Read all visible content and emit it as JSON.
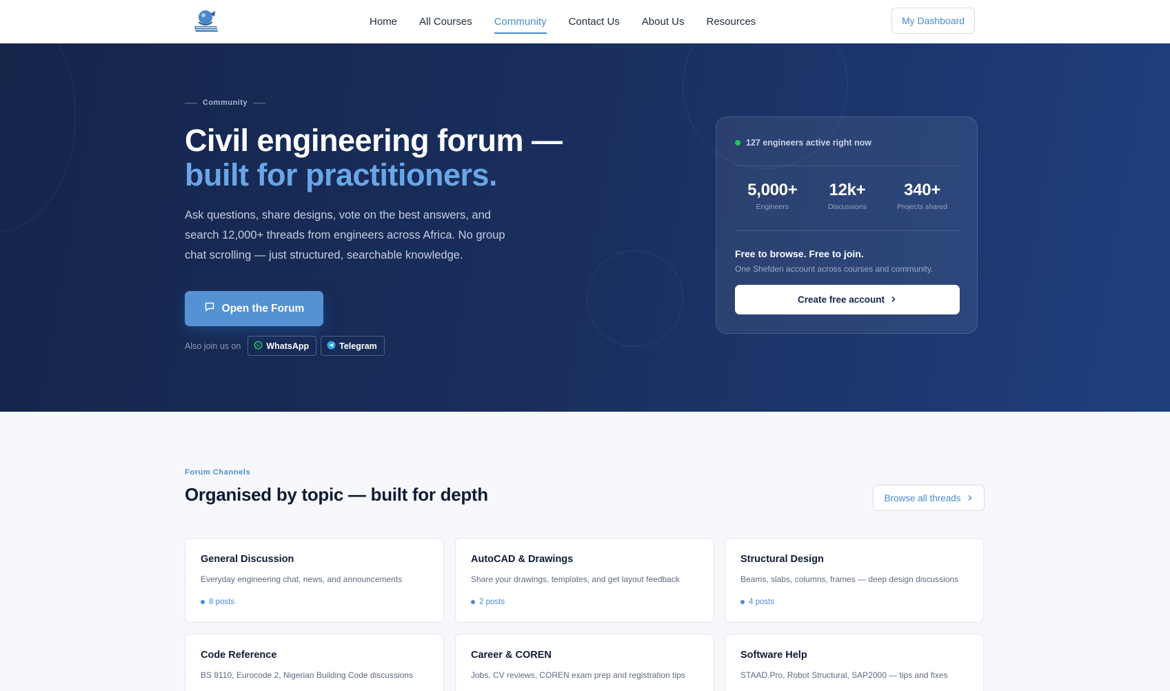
{
  "nav": {
    "items": [
      {
        "label": "Home",
        "active": false
      },
      {
        "label": "All Courses",
        "active": false
      },
      {
        "label": "Community",
        "active": true
      },
      {
        "label": "Contact Us",
        "active": false
      },
      {
        "label": "About Us",
        "active": false
      },
      {
        "label": "Resources",
        "active": false
      }
    ],
    "dashboard_label": "My Dashboard"
  },
  "hero": {
    "eyebrow": "Community",
    "title_line1": "Civil engineering forum —",
    "title_line2": "built for practitioners.",
    "subtitle": "Ask questions, share designs, vote on the best answers, and search 12,000+ threads from engineers across Africa. No group chat scrolling — just structured, searchable knowledge.",
    "cta_label": "Open the Forum",
    "join_label": "Also join us on",
    "whatsapp_label": "WhatsApp",
    "telegram_label": "Telegram"
  },
  "stats_card": {
    "active_text": "127 engineers active right now",
    "stats": [
      {
        "value": "5,000+",
        "label": "Engineers"
      },
      {
        "value": "12k+",
        "label": "Discussions"
      },
      {
        "value": "340+",
        "label": "Projects shared"
      }
    ],
    "free_title": "Free to browse. Free to join.",
    "free_sub": "One Shefden account across courses and community.",
    "create_label": "Create free account"
  },
  "channels": {
    "eyebrow": "Forum Channels",
    "title": "Organised by topic — built for depth",
    "browse_label": "Browse all threads",
    "items": [
      {
        "title": "General Discussion",
        "desc": "Everyday engineering chat, news, and announcements",
        "posts": "8 posts"
      },
      {
        "title": "AutoCAD & Drawings",
        "desc": "Share your drawings, templates, and get layout feedback",
        "posts": "2 posts"
      },
      {
        "title": "Structural Design",
        "desc": "Beams, slabs, columns, frames — deep design discussions",
        "posts": "4 posts"
      },
      {
        "title": "Code Reference",
        "desc": "BS 8110, Eurocode 2, Nigerian Building Code discussions",
        "posts": ""
      },
      {
        "title": "Career & COREN",
        "desc": "Jobs, CV reviews, COREN exam prep and registration tips",
        "posts": ""
      },
      {
        "title": "Software Help",
        "desc": "STAAD.Pro, Robot Structural, SAP2000 — tips and fixes",
        "posts": ""
      }
    ]
  },
  "colors": {
    "accent": "#4a8bcf",
    "hero_bg": "#1a2f5f",
    "status_green": "#22c55e"
  }
}
